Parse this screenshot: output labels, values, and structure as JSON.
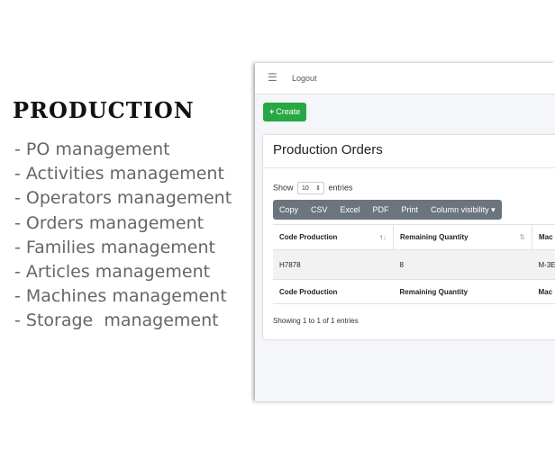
{
  "promo": {
    "title": "PRODUCTION",
    "features": [
      "- PO management",
      "- Activities management",
      "- Operators management",
      "- Orders management",
      "- Families management",
      "- Articles management",
      "- Machines management",
      "- Storage  management"
    ]
  },
  "navbar": {
    "menu_icon": "bars-icon",
    "logout_label": "Logout"
  },
  "toolbar": {
    "create_label": "Create"
  },
  "card": {
    "title": "Production Orders",
    "show_label": "Show",
    "entries_value": "10",
    "entries_label": "entries",
    "buttons": [
      "Copy",
      "CSV",
      "Excel",
      "PDF",
      "Print",
      "Column visibility"
    ],
    "columns": [
      "Code Production",
      "Remaining Quantity",
      "Mac"
    ],
    "rows": [
      {
        "code": "H7878",
        "remaining": "8",
        "machine": "M-3E"
      }
    ],
    "info": "Showing 1 to 1 of 1 entries"
  },
  "colors": {
    "accent_green": "#28a745",
    "button_gray": "#6c757d"
  }
}
